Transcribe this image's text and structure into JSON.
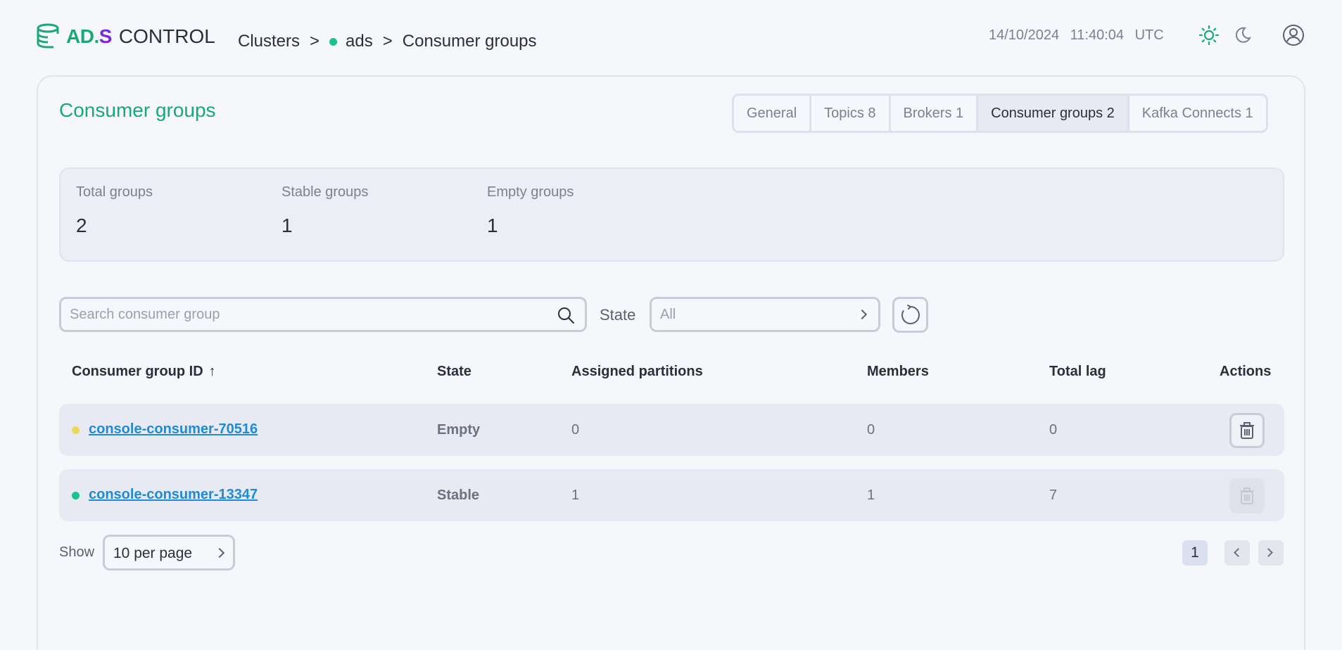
{
  "header": {
    "logo": {
      "ad": "AD.",
      "s": "S",
      "control": "CONTROL"
    },
    "breadcrumb": {
      "clusters": "Clusters",
      "separator": ">",
      "cluster": "ads",
      "page": "Consumer groups"
    },
    "date": "14/10/2024",
    "time": "11:40:04",
    "timezone": "UTC",
    "icons": [
      "sun-icon",
      "moon-icon",
      "user-icon"
    ]
  },
  "main": {
    "title": "Consumer groups",
    "tabs": [
      {
        "label": "General",
        "active": false
      },
      {
        "label": "Topics 8",
        "active": false
      },
      {
        "label": "Brokers 1",
        "active": false
      },
      {
        "label": "Consumer groups 2",
        "active": true
      },
      {
        "label": "Kafka Connects 1",
        "active": false
      }
    ],
    "stats": [
      {
        "label": "Total groups",
        "value": "2"
      },
      {
        "label": "Stable groups",
        "value": "1"
      },
      {
        "label": "Empty groups",
        "value": "1"
      }
    ],
    "search": {
      "placeholder": "Search consumer group",
      "value": ""
    },
    "state_filter": {
      "label": "State",
      "value": "All"
    },
    "table": {
      "columns": [
        "Consumer group ID",
        "State",
        "Assigned partitions",
        "Members",
        "Total lag",
        "Actions"
      ],
      "sort_indicator": "↑",
      "rows": [
        {
          "id": "console-consumer-70516",
          "state": "Empty",
          "assigned_partitions": "0",
          "members": "0",
          "total_lag": "0",
          "status_color": "#f0d75a",
          "delete_enabled": true
        },
        {
          "id": "console-consumer-13347",
          "state": "Stable",
          "assigned_partitions": "1",
          "members": "1",
          "total_lag": "7",
          "status_color": "#19c38e",
          "delete_enabled": false
        }
      ]
    },
    "pagination": {
      "show_label": "Show",
      "per_page": "10 per page",
      "current_page": "1"
    }
  },
  "colors": {
    "accent": "#1aa876",
    "link": "#1f8ad6",
    "brand_purple": "#7b2bd6"
  }
}
